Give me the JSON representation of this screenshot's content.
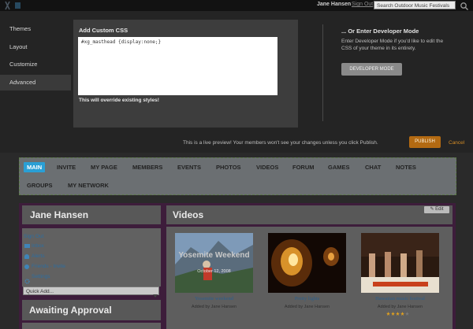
{
  "topbar": {
    "user_name": "Jane Hansen",
    "sign_out": "Sign Out",
    "search_placeholder": "Search Outdoor Music Festivals"
  },
  "sidebar": {
    "items": [
      {
        "label": "Themes"
      },
      {
        "label": "Layout"
      },
      {
        "label": "Customize"
      },
      {
        "label": "Advanced"
      }
    ]
  },
  "custom_css": {
    "title": "Add Custom CSS",
    "code": "#xg_masthead {display:none;}",
    "note": "This will override existing styles!"
  },
  "developer": {
    "title": "... Or Enter Developer Mode",
    "description": "Enter Developer Mode if you'd like to edit the CSS of your theme in its entirety.",
    "button": "DEVELOPER MODE"
  },
  "preview": {
    "note": "This is a live preview! Your members won't see your changes unless you click Publish.",
    "publish": "PUBLISH",
    "cancel": "Cancel"
  },
  "nav": {
    "row1": [
      "MAIN",
      "INVITE",
      "MY PAGE",
      "MEMBERS",
      "EVENTS",
      "PHOTOS",
      "VIDEOS",
      "FORUM",
      "GAMES",
      "CHAT",
      "NOTES"
    ],
    "row2": [
      "GROUPS",
      "MY NETWORK"
    ]
  },
  "profile": {
    "name": "Jane Hansen",
    "links": [
      "Sign Out",
      "Inbox",
      "Alerts",
      "Friends - Invite",
      "Settings"
    ],
    "quick_add": "Quick Add..."
  },
  "approval": {
    "title": "Awaiting Approval"
  },
  "videos": {
    "title": "Videos",
    "edit": "Edit",
    "items": [
      {
        "title": "Yosemite weekend",
        "added_by": "Added by Jane Hansen",
        "overlay": "Yosemite Weekend",
        "date": "October 12, 2008"
      },
      {
        "title": "Pretty lights",
        "added_by": "Added by Jane Hansen"
      },
      {
        "title": "Hawaiian music festival",
        "added_by": "Added by Jane Hansen",
        "rating": 4
      }
    ]
  },
  "colors": {
    "accent_blue": "#2a9fd5",
    "publish_orange": "#b36a12",
    "purple_bg": "#3d1d3b"
  }
}
